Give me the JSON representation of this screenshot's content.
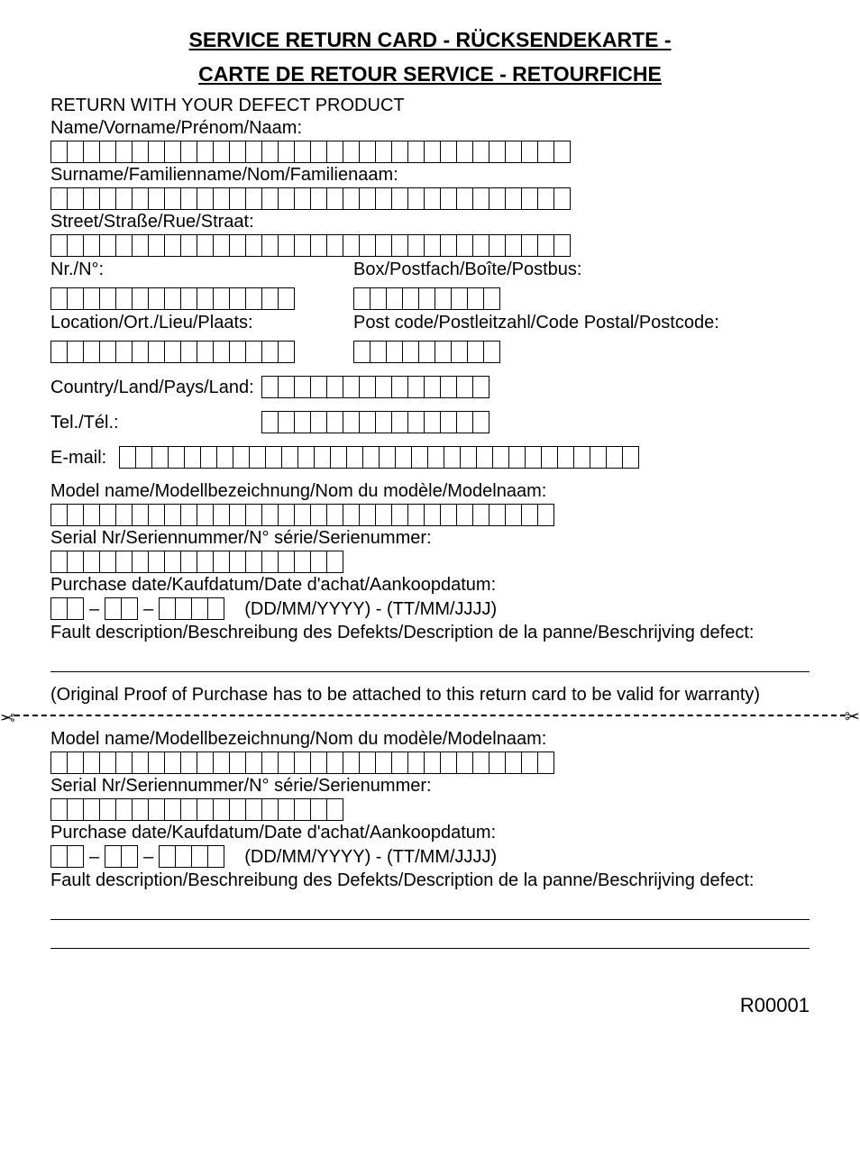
{
  "header": {
    "title_line1": "SERVICE RETURN CARD - RÜCKSENDEKARTE -",
    "title_line2": "CARTE DE RETOUR SERVICE - RETOURFICHE",
    "subtitle": "RETURN WITH YOUR DEFECT PRODUCT"
  },
  "fields": {
    "name": {
      "label": "Name/Vorname/Prénom/Naam:",
      "boxes": 32
    },
    "surname": {
      "label": "Surname/Familienname/Nom/Familienaam:",
      "boxes": 32
    },
    "street": {
      "label": "Street/Straße/Rue/Straat:",
      "boxes": 32
    },
    "nr": {
      "label": "Nr./N°:",
      "boxes": 15
    },
    "box": {
      "label": "Box/Postfach/Boîte/Postbus:",
      "boxes": 9
    },
    "location": {
      "label": "Location/Ort./Lieu/Plaats:",
      "boxes": 15
    },
    "postcode": {
      "label": "Post code/Postleitzahl/Code Postal/Postcode:",
      "boxes": 9
    },
    "country": {
      "label": "Country/Land/Pays/Land:",
      "boxes": 14
    },
    "tel": {
      "label": "Tel./Tél.:",
      "boxes": 14
    },
    "email": {
      "label": "E-mail:",
      "boxes": 32
    },
    "model1": {
      "label": "Model name/Modellbezeichnung/Nom du modèle/Modelnaam:",
      "boxes": 31
    },
    "serial1": {
      "label": "Serial Nr/Seriennummer/N° série/Serienummer:",
      "boxes": 18
    },
    "purchase1": {
      "label": "Purchase date/Kaufdatum/Date d'achat/Aankoopdatum:",
      "format": "(DD/MM/YYYY) - (TT/MM/JJJJ)"
    },
    "fault1": {
      "label": "Fault description/Beschreibung des Defekts/Description de la panne/Beschrijving defect:"
    },
    "model2": {
      "label": "Model name/Modellbezeichnung/Nom du modèle/Modelnaam:",
      "boxes": 31
    },
    "serial2": {
      "label": "Serial Nr/Seriennummer/N° série/Serienummer:",
      "boxes": 18
    },
    "purchase2": {
      "label": "Purchase date/Kaufdatum/Date d'achat/Aankoopdatum:",
      "format": "(DD/MM/YYYY) - (TT/MM/JJJJ)"
    },
    "fault2": {
      "label": "Fault description/Beschreibung des Defekts/Description de la panne/Beschrijving defect:"
    }
  },
  "note": "(Original Proof of Purchase has to be attached to this return card to be valid for warranty)",
  "footer": "R00001",
  "date_sep": "–"
}
